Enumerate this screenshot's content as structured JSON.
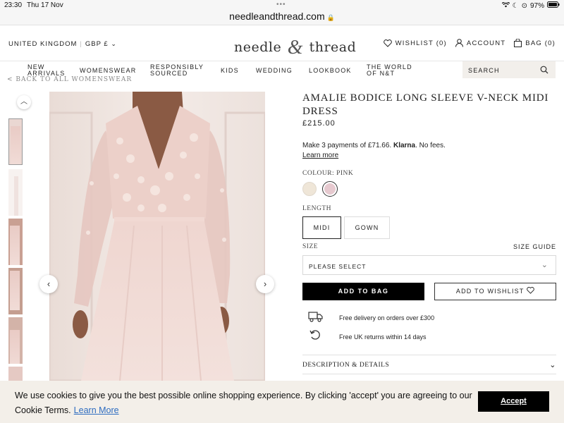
{
  "status_bar": {
    "time": "23:30",
    "date": "Thu 17 Nov",
    "battery": "97%",
    "url": "needleandthread.com"
  },
  "header": {
    "region": "UNITED KINGDOM",
    "currency": "GBP £",
    "logo_left": "needle",
    "logo_amp": "&",
    "logo_right": "thread",
    "wishlist": "WISHLIST (0)",
    "account": "ACCOUNT",
    "bag": "BAG (0)"
  },
  "nav": {
    "items": [
      "NEW ARRIVALS",
      "WOMENSWEAR",
      "RESPONSIBLY SOURCED",
      "KIDS",
      "WEDDING",
      "LOOKBOOK",
      "THE WORLD OF N&T"
    ],
    "search_placeholder": "SEARCH"
  },
  "back_link": "< BACK TO ALL WOMENSWEAR",
  "product": {
    "title": "AMALIE BODICE LONG SLEEVE V-NECK MIDI DRESS",
    "price": "£215.00",
    "klarna_text_1": "Make 3 payments of £71.66.",
    "klarna_brand": "Klarna",
    "klarna_text_2": ". No fees.",
    "learn_more": "Learn more",
    "colour_label": "COLOUR: PINK",
    "colours": [
      {
        "name": "ivory",
        "hex": "#efe6d8",
        "selected": false
      },
      {
        "name": "pink",
        "hex": "#e6c9cf",
        "selected": true
      }
    ],
    "length_label": "LENGTH",
    "lengths": [
      {
        "label": "MIDI",
        "selected": true
      },
      {
        "label": "GOWN",
        "selected": false
      }
    ],
    "size_label": "SIZE",
    "size_guide": "SIZE GUIDE",
    "size_select": "PLEASE SELECT",
    "add_to_bag": "ADD TO BAG",
    "add_to_wishlist": "ADD TO WISHLIST",
    "perks": [
      {
        "icon": "delivery-truck-icon",
        "text": "Free delivery on orders over £300"
      },
      {
        "icon": "returns-icon",
        "text": "Free UK returns within 14 days"
      }
    ],
    "description_label": "DESCRIPTION & DETAILS"
  },
  "cookie": {
    "text": "We use cookies to give you the best possible online shopping experience. By clicking 'accept' you are agreeing to our Cookie Terms.",
    "learn_more": "Learn More",
    "accept": "Accept"
  },
  "colors": {
    "accent": "#000000",
    "cookie_bg": "#f3efe9",
    "search_bg": "#f2efeb",
    "link": "#2d6cc0"
  }
}
